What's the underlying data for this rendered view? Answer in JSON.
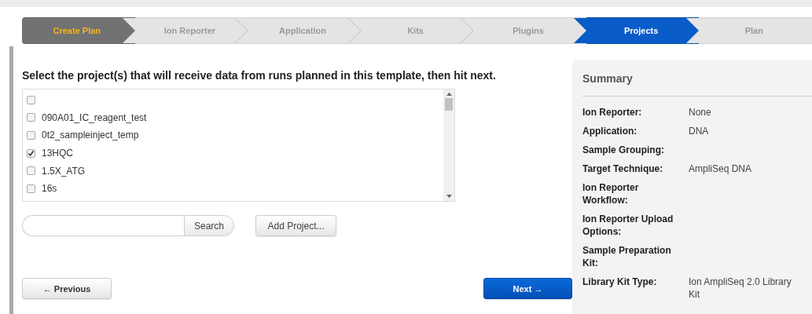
{
  "wizard_steps": [
    {
      "label": "Create Plan",
      "kind": "start",
      "selected": false
    },
    {
      "label": "Ion Reporter",
      "kind": "step",
      "selected": false
    },
    {
      "label": "Application",
      "kind": "step",
      "selected": false
    },
    {
      "label": "Kits",
      "kind": "step",
      "selected": false
    },
    {
      "label": "Plugins",
      "kind": "step",
      "selected": false
    },
    {
      "label": "Projects",
      "kind": "step",
      "selected": true
    },
    {
      "label": "Plan",
      "kind": "step",
      "selected": false
    }
  ],
  "instruction": "Select the project(s) that will receive data from runs planned in this template, then hit next.",
  "projects": [
    {
      "checked": false
    },
    {
      "name": "090A01_IC_reagent_test",
      "checked": false
    },
    {
      "name": "0t2_sampleinject_temp",
      "checked": false
    },
    {
      "name": "13HQC",
      "checked": true
    },
    {
      "name": "1.5X_ATG",
      "checked": false
    },
    {
      "name": "16s",
      "checked": false
    }
  ],
  "search": {
    "button": "Search"
  },
  "add_project": "Add Project...",
  "previous": "← Previous",
  "next": "Next →",
  "summary": {
    "title": "Summary",
    "rows": [
      {
        "label": "Ion Reporter:",
        "value": "None"
      },
      {
        "label": "Application:",
        "value": "DNA"
      },
      {
        "label": "Sample Grouping:"
      },
      {
        "label": "Target Technique:",
        "value": "AmpliSeq DNA"
      },
      {
        "label": "Ion Reporter Workflow:"
      },
      {
        "label": "Ion Reporter Upload Options:"
      },
      {
        "label": "Sample Preparation Kit:"
      },
      {
        "label": "Library Kit Type:",
        "value": "Ion AmpliSeq 2.0 Library Kit"
      }
    ]
  }
}
